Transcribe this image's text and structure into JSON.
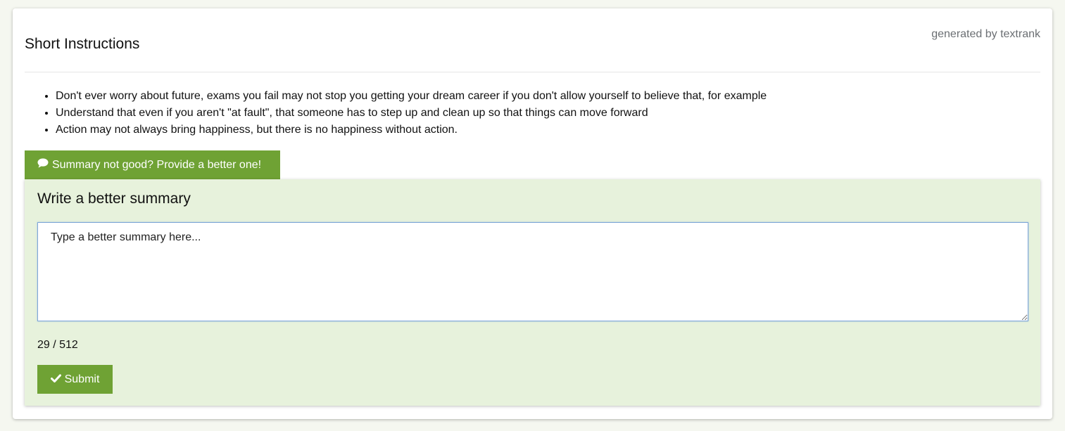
{
  "header": {
    "title": "Short Instructions",
    "generated_by": "generated by textrank"
  },
  "summary_items": [
    "Don't ever worry about future, exams you fail may not stop you getting your dream career if you don't allow yourself to believe that, for example",
    "Understand that even if you aren't \"at fault\", that someone has to step up and clean up so that things can move forward",
    "Action may not always bring happiness, but there is no happiness without action."
  ],
  "feedback_toggle": {
    "label": "Summary not good? Provide a better one!",
    "icon": "comment-icon"
  },
  "better_summary": {
    "title": "Write a better summary",
    "placeholder": "Type a better summary here...",
    "value": "",
    "counter": "29 / 512",
    "submit_label": "Submit",
    "submit_icon": "check-icon"
  },
  "colors": {
    "accent": "#6fa234",
    "panel_background": "#e7f2dc",
    "input_focus_border": "#7ea6d8",
    "muted_text": "#6b6f73"
  }
}
